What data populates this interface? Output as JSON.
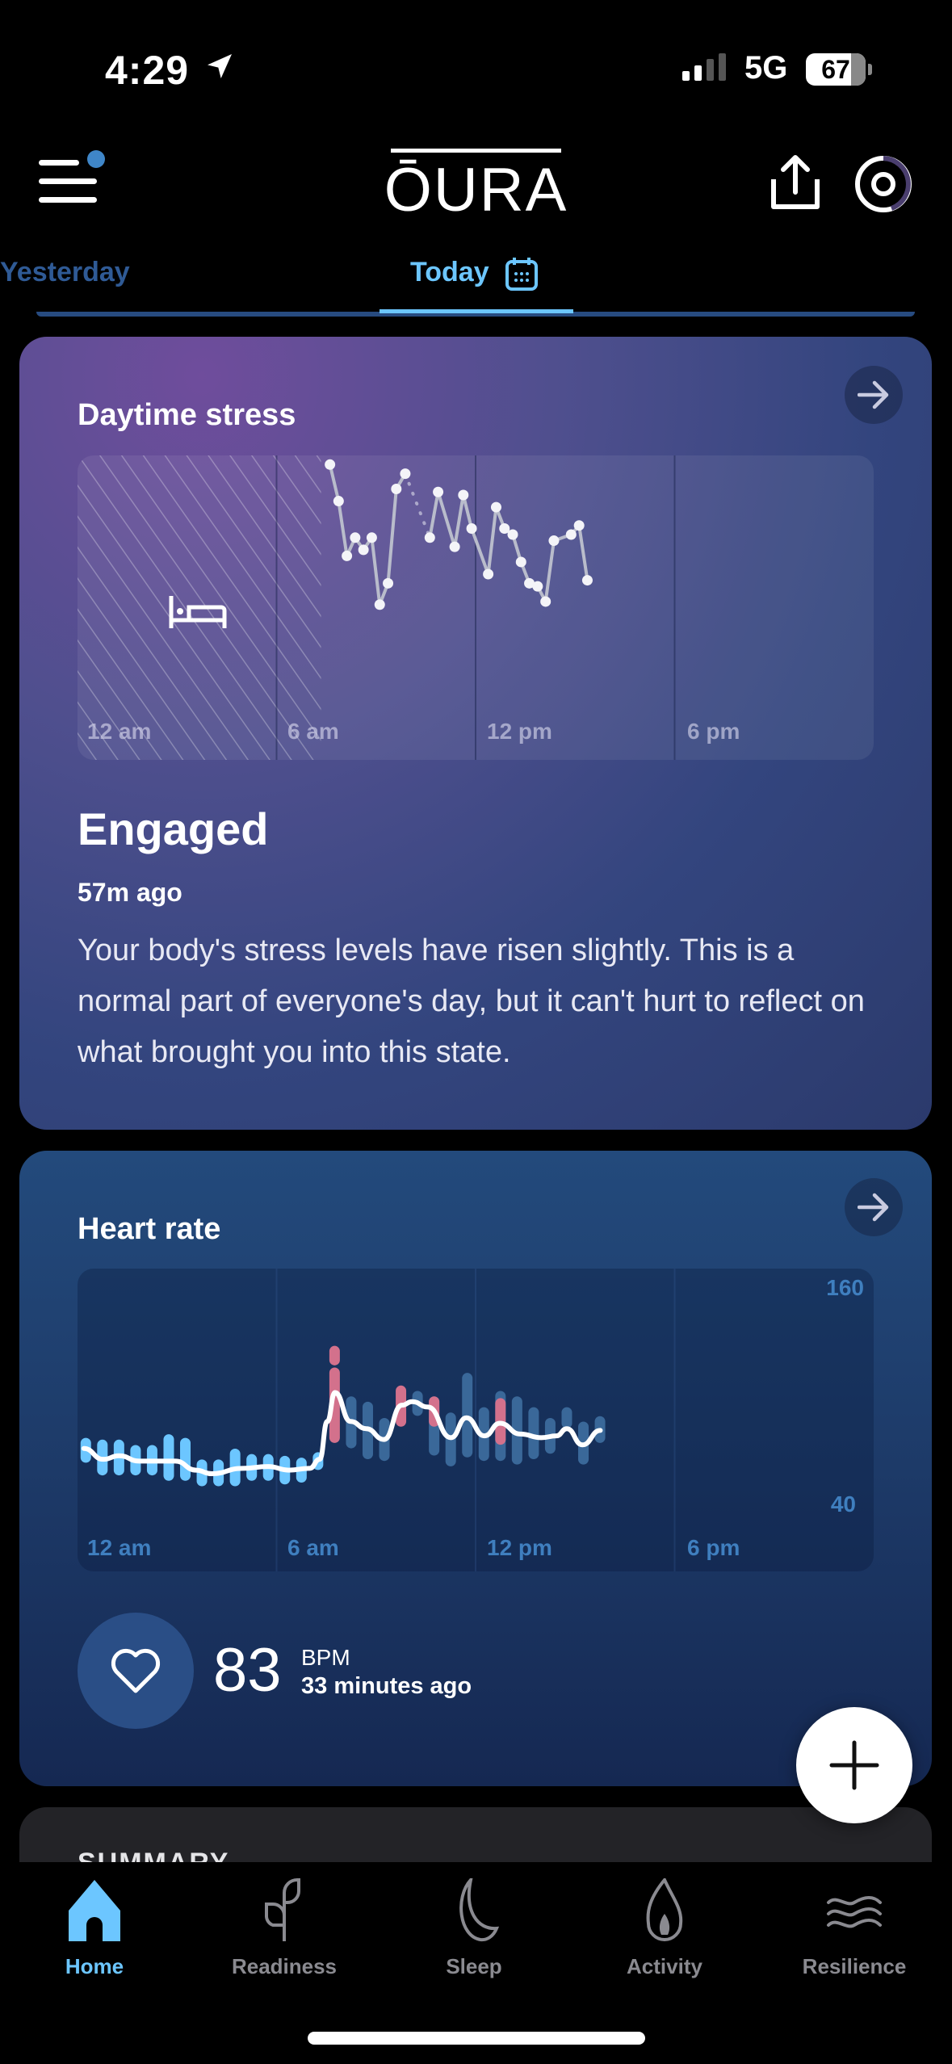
{
  "status_bar": {
    "time": "4:29",
    "network": "5G",
    "battery": "67"
  },
  "header": {
    "logo": "ŌURA",
    "notification_dot_color": "#3f86c8"
  },
  "tabs": [
    {
      "label": "Yesterday",
      "active": false
    },
    {
      "label": "Today",
      "active": true
    }
  ],
  "stress_card": {
    "title": "Daytime stress",
    "state": "Engaged",
    "updated": "57m ago",
    "description": "Your body's stress levels have risen slightly. This is a normal part of everyone's day, but it can't hurt to reflect on what brought you into this state.",
    "chart_data": {
      "type": "line",
      "x_ticks": [
        "12 am",
        "6 am",
        "12 pm",
        "6 pm"
      ],
      "x_unit": "hour of day",
      "x_range": [
        0,
        24
      ],
      "y_unit": "relative stress level (0-1)",
      "sleep_period_hours": [
        0,
        7.34
      ],
      "segments": [
        {
          "style": "solid",
          "points": [
            [
              7.61,
              0.97
            ],
            [
              7.87,
              0.85
            ],
            [
              8.12,
              0.67
            ],
            [
              8.37,
              0.73
            ],
            [
              8.62,
              0.69
            ],
            [
              8.87,
              0.73
            ],
            [
              9.11,
              0.51
            ],
            [
              9.36,
              0.58
            ],
            [
              9.61,
              0.89
            ],
            [
              9.88,
              0.94
            ]
          ]
        },
        {
          "style": "dotted",
          "points": [
            [
              9.88,
              0.94
            ],
            [
              10.62,
              0.73
            ]
          ]
        },
        {
          "style": "solid",
          "points": [
            [
              10.62,
              0.73
            ],
            [
              10.87,
              0.88
            ],
            [
              11.37,
              0.7
            ],
            [
              11.63,
              0.87
            ],
            [
              11.88,
              0.76
            ],
            [
              12.38,
              0.61
            ],
            [
              12.62,
              0.83
            ],
            [
              12.87,
              0.76
            ],
            [
              13.12,
              0.74
            ],
            [
              13.37,
              0.65
            ],
            [
              13.62,
              0.58
            ],
            [
              13.87,
              0.57
            ],
            [
              14.11,
              0.52
            ],
            [
              14.36,
              0.72
            ],
            [
              14.88,
              0.74
            ],
            [
              15.12,
              0.77
            ],
            [
              15.37,
              0.59
            ]
          ]
        }
      ]
    }
  },
  "heart_card": {
    "title": "Heart rate",
    "value": "83",
    "unit": "BPM",
    "updated": "33 minutes ago",
    "chart_data": {
      "type": "line",
      "x_ticks": [
        "12 am",
        "6 am",
        "12 pm",
        "6 pm"
      ],
      "x_range": [
        0,
        24
      ],
      "y_ticks": [
        "160",
        "40"
      ],
      "ylim": [
        40,
        160
      ],
      "colors": {
        "sleep": "#6cc6ff",
        "day": "#3a6899",
        "elevated": "#d3718c",
        "line": "#ffffff"
      },
      "bars": [
        [
          0.25,
          66,
          74,
          "sleep"
        ],
        [
          0.75,
          59,
          73,
          "sleep"
        ],
        [
          1.25,
          59,
          73,
          "sleep"
        ],
        [
          1.75,
          59,
          70,
          "sleep"
        ],
        [
          2.25,
          59,
          70,
          "sleep"
        ],
        [
          2.75,
          56,
          76,
          "sleep"
        ],
        [
          3.25,
          56,
          74,
          "sleep"
        ],
        [
          3.75,
          53,
          62,
          "sleep"
        ],
        [
          4.25,
          53,
          62,
          "sleep"
        ],
        [
          4.75,
          53,
          68,
          "sleep"
        ],
        [
          5.25,
          56,
          65,
          "sleep"
        ],
        [
          5.75,
          56,
          65,
          "sleep"
        ],
        [
          6.25,
          54,
          64,
          "sleep"
        ],
        [
          6.75,
          55,
          63,
          "sleep"
        ],
        [
          7.25,
          62,
          66,
          "sleep"
        ],
        [
          7.75,
          77,
          113,
          "elevated"
        ],
        [
          7.75,
          120,
          125,
          "elevated"
        ],
        [
          8.25,
          74,
          97,
          "day"
        ],
        [
          8.75,
          68,
          94,
          "day"
        ],
        [
          9.25,
          67,
          85,
          "day"
        ],
        [
          9.75,
          86,
          103,
          "elevated"
        ],
        [
          10.25,
          92,
          100,
          "day"
        ],
        [
          10.75,
          70,
          97,
          "day"
        ],
        [
          10.75,
          86,
          97,
          "elevated"
        ],
        [
          11.25,
          64,
          88,
          "day"
        ],
        [
          11.75,
          69,
          110,
          "day"
        ],
        [
          12.25,
          67,
          91,
          "day"
        ],
        [
          12.75,
          67,
          100,
          "day"
        ],
        [
          12.75,
          76,
          96,
          "elevated"
        ],
        [
          13.25,
          65,
          97,
          "day"
        ],
        [
          13.75,
          68,
          91,
          "day"
        ],
        [
          14.25,
          71,
          85,
          "day"
        ],
        [
          14.75,
          85,
          91,
          "day"
        ],
        [
          15.25,
          65,
          83,
          "day"
        ],
        [
          15.75,
          77,
          86,
          "day"
        ]
      ],
      "line": [
        [
          0.19,
          71
        ],
        [
          0.78,
          65
        ],
        [
          1.25,
          67
        ],
        [
          1.86,
          64
        ],
        [
          2.95,
          64
        ],
        [
          3.57,
          59
        ],
        [
          4.04,
          57
        ],
        [
          4.97,
          60
        ],
        [
          5.75,
          61
        ],
        [
          6.37,
          59
        ],
        [
          7.0,
          60
        ],
        [
          7.3,
          65
        ],
        [
          7.53,
          86
        ],
        [
          7.76,
          102
        ],
        [
          8.23,
          86
        ],
        [
          8.7,
          82
        ],
        [
          9.24,
          76
        ],
        [
          9.78,
          95
        ],
        [
          10.09,
          97
        ],
        [
          10.56,
          94
        ],
        [
          11.26,
          77
        ],
        [
          11.72,
          88
        ],
        [
          12.27,
          78
        ],
        [
          12.73,
          85
        ],
        [
          13.35,
          79
        ],
        [
          13.98,
          77
        ],
        [
          14.44,
          78
        ],
        [
          14.75,
          82
        ],
        [
          15.22,
          73
        ],
        [
          15.76,
          81
        ]
      ]
    }
  },
  "fab": {
    "icon": "plus-icon"
  },
  "summary": {
    "title": "SUMMARY"
  },
  "bottom_nav": [
    {
      "label": "Home",
      "icon": "home-icon",
      "active": true
    },
    {
      "label": "Readiness",
      "icon": "sprout-icon",
      "active": false
    },
    {
      "label": "Sleep",
      "icon": "moon-icon",
      "active": false
    },
    {
      "label": "Activity",
      "icon": "flame-icon",
      "active": false
    },
    {
      "label": "Resilience",
      "icon": "waves-icon",
      "active": false
    }
  ]
}
